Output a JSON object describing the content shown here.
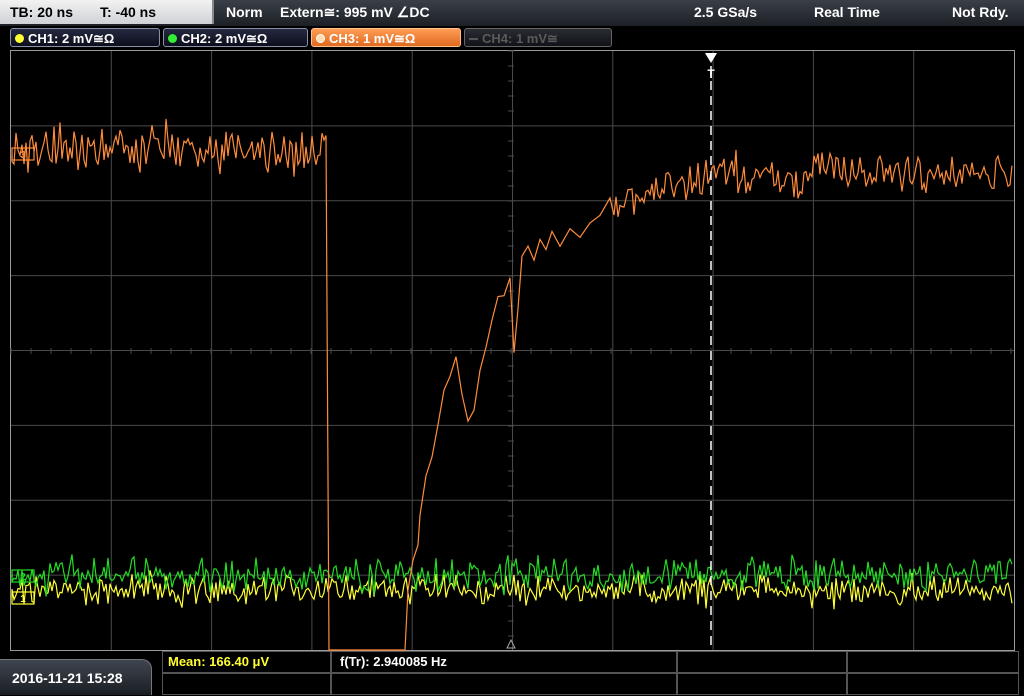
{
  "header": {
    "timebase": "TB: 20 ns",
    "trigger_time": "T: -40 ns",
    "trigger_mode": "Norm",
    "trigger_source": "Extern≅: 995 mV ∠DC",
    "sample_rate": "2.5 GSa/s",
    "acq_mode": "Real Time",
    "status": "Not Rdy."
  },
  "channels": [
    {
      "label": "CH1: 2 mV≅Ω",
      "color": "#ffff33",
      "active": true
    },
    {
      "label": "CH2: 2 mV≅Ω",
      "color": "#33ee33",
      "active": true
    },
    {
      "label": "CH3: 1 mV≅Ω",
      "color": "#ff8c3a",
      "active": true,
      "selected": true
    },
    {
      "label": "CH4: 1 mV≅",
      "color": "#555555",
      "active": false
    }
  ],
  "waveform_markers": {
    "trigger_marker": "T",
    "ch3_level_label": "3",
    "ch2_level_label": "2",
    "ch1_level_label": "1"
  },
  "measurements": {
    "mean": "Mean: 166.40 μV",
    "freq": "f(Tr): 2.940085 Hz"
  },
  "footer": {
    "datetime": "2016-11-21 15:28"
  },
  "colors": {
    "ch1": "#ffff33",
    "ch2": "#22dd22",
    "ch3": "#ff8c3a",
    "grid": "#4a4a4a"
  }
}
